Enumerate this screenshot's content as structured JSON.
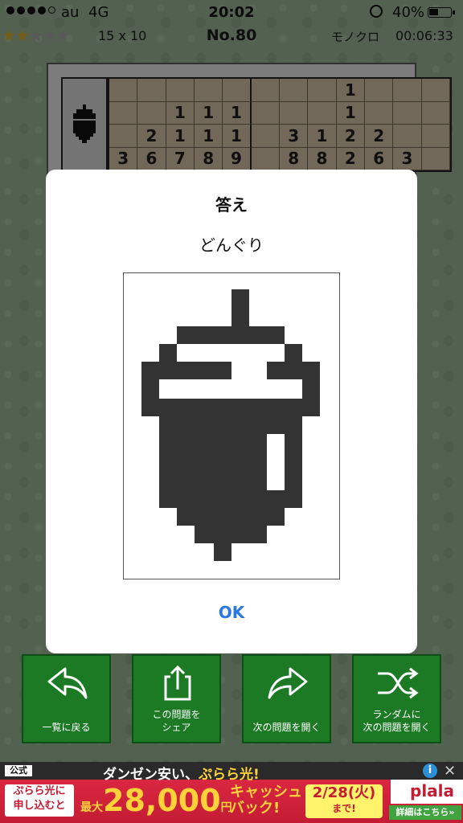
{
  "status_bar": {
    "carrier": "au",
    "network": "4G",
    "time": "20:02",
    "battery": "40%"
  },
  "header": {
    "stars_filled": 2,
    "stars_total": 5,
    "size": "15 x 10",
    "puzzle_no": "No.80",
    "mode": "モノクロ",
    "timer": "00:06:33"
  },
  "board": {
    "thumbnail_icon": "acorn-icon",
    "column_clues": [
      [
        "",
        "",
        "",
        "",
        "",
        "",
        "",
        "",
        "1",
        "",
        "",
        ""
      ],
      [
        "",
        "",
        "1",
        "1",
        "1",
        "",
        "",
        "",
        "1",
        "",
        "",
        ""
      ],
      [
        "",
        "2",
        "1",
        "1",
        "1",
        "",
        "3",
        "1",
        "2",
        "2",
        "",
        ""
      ],
      [
        "3",
        "6",
        "7",
        "8",
        "9",
        "",
        "8",
        "8",
        "2",
        "6",
        "3",
        ""
      ]
    ]
  },
  "dialog": {
    "title": "答え",
    "answer_name": "どんぐり",
    "ok_label": "OK"
  },
  "buttons": [
    {
      "icon": "back-arrow-icon",
      "label": "一覧に戻る"
    },
    {
      "icon": "share-icon",
      "label": "この問題を\nシェア"
    },
    {
      "icon": "forward-arrow-icon",
      "label": "次の問題を開く"
    },
    {
      "icon": "shuffle-icon",
      "label": "ランダムに\n次の問題を開く"
    }
  ],
  "ad": {
    "official": "公式",
    "tagline_white": "ダンゼン安い、",
    "tagline_yellow": "ぷらら光!",
    "cta": "ぷらら光に\n申し込むと",
    "max_prefix": "最大",
    "amount": "28,000",
    "yen": "円",
    "cashback": "キャッシュ\nバック!",
    "date": "2/28(火)",
    "date_suffix": "まで!",
    "brand": "plala",
    "detail": "詳細はこちら»"
  },
  "colors": {
    "accent_ok": "#2a7ae2",
    "button_green": "#1c7a24",
    "pixel_dark": "#333333"
  }
}
